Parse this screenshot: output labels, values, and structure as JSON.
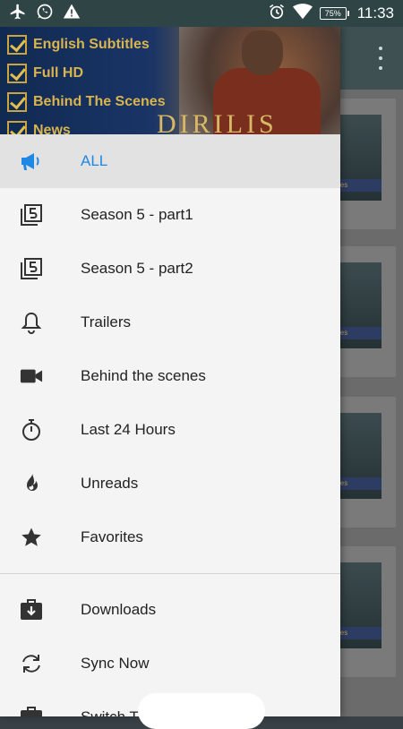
{
  "status_bar": {
    "time": "11:33",
    "battery": "75%",
    "icons": [
      "airplane-icon",
      "whatsapp-icon",
      "warning-icon",
      "alarm-icon",
      "wifi-icon",
      "battery-icon"
    ]
  },
  "drawer_header": {
    "items": [
      "English Subtitles",
      "Full HD",
      "Behind The Scenes",
      "News"
    ],
    "logo": "DIRILIS"
  },
  "menu": {
    "items": [
      {
        "label": "ALL",
        "icon": "megaphone-icon",
        "active": true
      },
      {
        "label": "Season 5 - part1",
        "icon": "numbered-layers-icon"
      },
      {
        "label": "Season 5 - part2",
        "icon": "numbered-layers-icon"
      },
      {
        "label": "Trailers",
        "icon": "bell-icon"
      },
      {
        "label": "Behind the scenes",
        "icon": "video-camera-icon"
      },
      {
        "label": "Last 24 Hours",
        "icon": "stopwatch-icon"
      },
      {
        "label": "Unreads",
        "icon": "flame-icon"
      },
      {
        "label": "Favorites",
        "icon": "star-icon"
      }
    ],
    "secondary_items": [
      {
        "label": "Downloads",
        "icon": "download-box-icon"
      },
      {
        "label": "Sync Now",
        "icon": "sync-icon"
      },
      {
        "label": "Switch Th",
        "icon": "palette-icon"
      }
    ]
  },
  "background": {
    "card_label": "itles",
    "colors": {
      "accent": "#1e88e5",
      "toolbar": "#3e5051",
      "gold": "#d9b44f"
    }
  }
}
